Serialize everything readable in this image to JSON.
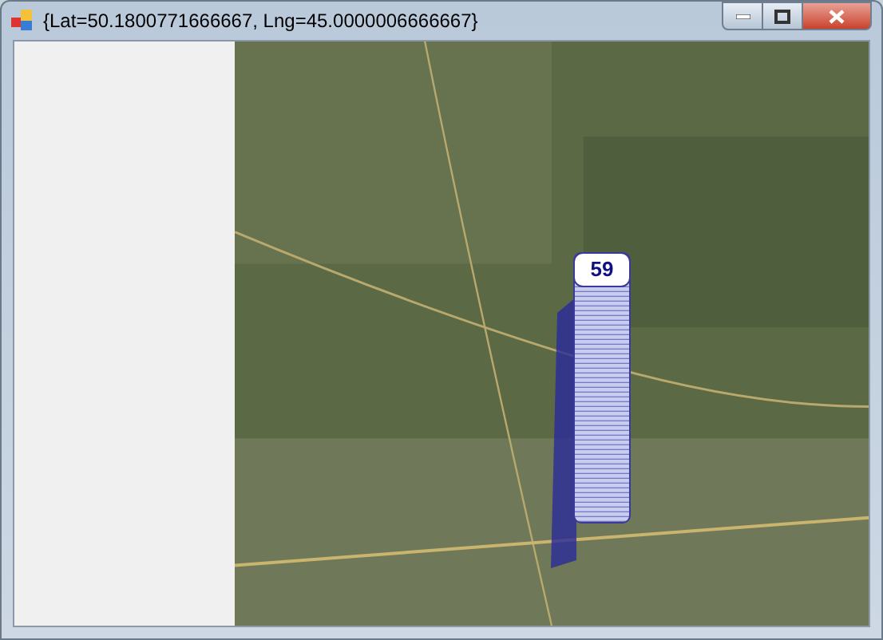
{
  "window": {
    "title": "{Lat=50.1800771666667, Lng=45.0000006666667}"
  },
  "map": {
    "marker": {
      "count": "59"
    }
  }
}
